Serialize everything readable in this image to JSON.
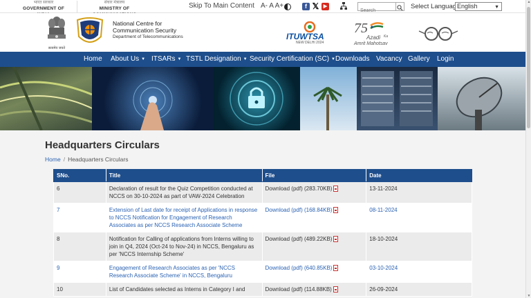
{
  "gov": {
    "india_hi": "भारत सरकार",
    "india_en": "GOVERNMENT OF INDIA",
    "ministry_hi": "संचार मंत्रालय",
    "ministry_en": "MINISTRY OF COMMUNICATIONS"
  },
  "toolbar": {
    "skip": "Skip To Main Content",
    "font_sizes": "A- A A+",
    "search_placeholder": "Search",
    "language_label": "Select Language:",
    "language_value": "English"
  },
  "header": {
    "emblem_caption": "सत्यमेव जयते",
    "org_line1": "National Centre for",
    "org_line2": "Communication Security",
    "org_line3": "Department of Telecommunications",
    "itu_text": "ITUWTSA",
    "itu_sub": "NEW DELHI 2024",
    "azadi_text1": "Azadi",
    "azadi_text2": "Ka",
    "azadi_text3": "Amrit Mahotsav"
  },
  "nav": {
    "items": [
      {
        "label": "Home",
        "dropdown": false
      },
      {
        "label": "About Us",
        "dropdown": true
      },
      {
        "label": "ITSARs",
        "dropdown": true
      },
      {
        "label": "TSTL Designation",
        "dropdown": true
      },
      {
        "label": "Security Certification (SC)",
        "dropdown": true
      },
      {
        "label": "Downloads",
        "dropdown": false
      },
      {
        "label": "Vacancy",
        "dropdown": false
      },
      {
        "label": "Gallery",
        "dropdown": false
      },
      {
        "label": "Login",
        "dropdown": false
      }
    ]
  },
  "page": {
    "title": "Headquarters Circulars",
    "breadcrumb_home": "Home",
    "breadcrumb_current": "Headquarters Circulars"
  },
  "table": {
    "headers": [
      "SNo.",
      "Title",
      "File",
      "Date"
    ],
    "rows": [
      {
        "sno": "6",
        "title": "Declaration of result for the Quiz Competition conducted at NCCS on 30-10-2024 as part of VAW-2024 Celebration",
        "file": "Download (pdf) (283.70KB)",
        "date": "13-11-2024"
      },
      {
        "sno": "7",
        "title": "Extension of Last date for receipt of Applications in response to NCCS Notification for Engagement of Research Associates as per NCCS Research Associate Scheme",
        "file": "Download (pdf) (168.84KB)",
        "date": "08-11-2024"
      },
      {
        "sno": "8",
        "title": "Notification for Calling of applications from Interns willing to join in Q4, 2024 (Oct-24 to Nov-24) in NCCS, Bengaluru as per 'NCCS Internship Scheme'",
        "file": "Download (pdf) (489.22KB)",
        "date": "18-10-2024"
      },
      {
        "sno": "9",
        "title": "Engagement of Research Associates as per 'NCCS Research Associate Scheme' in NCCS, Bengaluru",
        "file": "Download (pdf) (640.85KB)",
        "date": "03-10-2024"
      },
      {
        "sno": "10",
        "title": "List of Candidates selected as Interns in Category I and",
        "file": "Download (pdf) (114.88KB)",
        "date": "26-09-2024"
      }
    ]
  },
  "colors": {
    "nav_bg": "#1e4e8c",
    "link": "#2a62b3"
  }
}
